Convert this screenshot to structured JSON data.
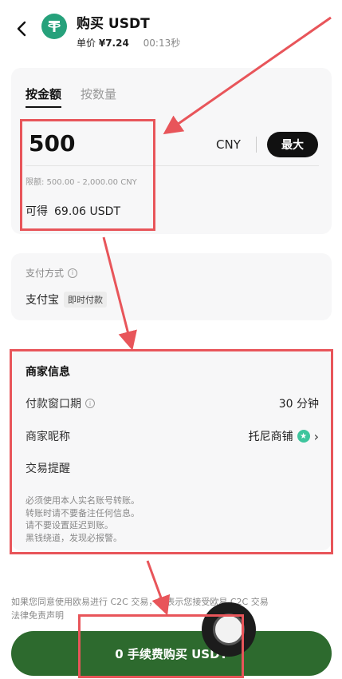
{
  "header": {
    "title": "购买 USDT",
    "price_label": "单价",
    "price_value": "¥7.24",
    "timer": "00:13秒"
  },
  "amount_card": {
    "tabs": [
      {
        "label": "按金额",
        "active": true
      },
      {
        "label": "按数量",
        "active": false
      }
    ],
    "amount": "500",
    "currency": "CNY",
    "max_label": "最大",
    "limit_text": "限额: 500.00 - 2,000.00 CNY",
    "receive_label": "可得",
    "receive_value": "69.06 USDT"
  },
  "payment": {
    "label": "支付方式",
    "method": "支付宝",
    "badge": "即时付款"
  },
  "merchant": {
    "title": "商家信息",
    "window_label": "付款窗口期",
    "window_value": "30 分钟",
    "nickname_label": "商家昵称",
    "nickname_value": "托尼商铺",
    "reminder_label": "交易提醒",
    "notice_lines": [
      "必须使用本人实名账号转账。",
      "转账时请不要备注任何信息。",
      "请不要设置延迟到账。",
      "黑钱绕道，发现必报警。"
    ]
  },
  "disclaimer": {
    "line1": "如果您同意使用欧易进行 C2C 交易，即表示您接受欧易 C2C 交易",
    "line2": "法律免责声明"
  },
  "buy_button": "0 手续费购买 USDT",
  "colors": {
    "buy_button": "#2d6a2e",
    "annotation": "#e8555a",
    "tether": "#26a17b",
    "verified": "#3ec59d"
  }
}
